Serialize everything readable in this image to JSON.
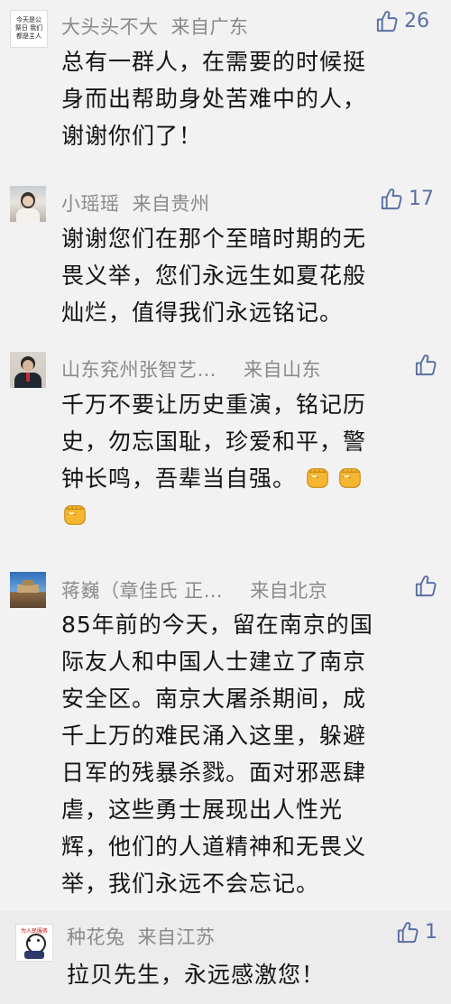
{
  "comments": [
    {
      "name": "大头头不大",
      "location": "来自广东",
      "likes": "26",
      "avatar_text": "今天是公祭日 我们都是主人",
      "lines": [
        "总有一群人，在需要的时候挺",
        "身而出帮助身处苦难中的人，",
        "谢谢你们了！"
      ]
    },
    {
      "name": "小瑶瑶",
      "location": "来自贵州",
      "likes": "17",
      "lines": [
        "谢谢您们在那个至暗时期的无",
        "畏义举，您们永远生如夏花般",
        "灿烂，值得我们永远铭记。"
      ]
    },
    {
      "name": "山东兖州张智艺…",
      "location": "来自山东",
      "likes": "",
      "lines": [
        "千万不要让历史重演，铭记历",
        "史，勿忘国耻，珍爱和平，警",
        "钟长鸣，吾辈当自强。"
      ],
      "emoji": "raised-fist"
    },
    {
      "name": "蒋巍（章佳氏 正…",
      "location": "来自北京",
      "likes": "",
      "lines": [
        "85年前的今天，留在南京的国",
        "际友人和中国人士建立了南京",
        "安全区。南京大屠杀期间，成",
        "千上万的难民涌入这里，躲避",
        "日军的残暴杀戮。面对邪恶肆",
        "虐，这些勇士展现出人性光",
        "辉，他们的人道精神和无畏义",
        "举，我们永远不会忘记。"
      ]
    },
    {
      "name": "种花兔",
      "location": "来自江苏",
      "likes": "1",
      "avatar_text": "为人民服务",
      "lines": [
        "拉贝先生，永远感激您！"
      ]
    }
  ],
  "colors": {
    "name": "#8a8a8a",
    "like": "#5a6fa3",
    "text": "#141414",
    "fist": "#f5b731"
  }
}
